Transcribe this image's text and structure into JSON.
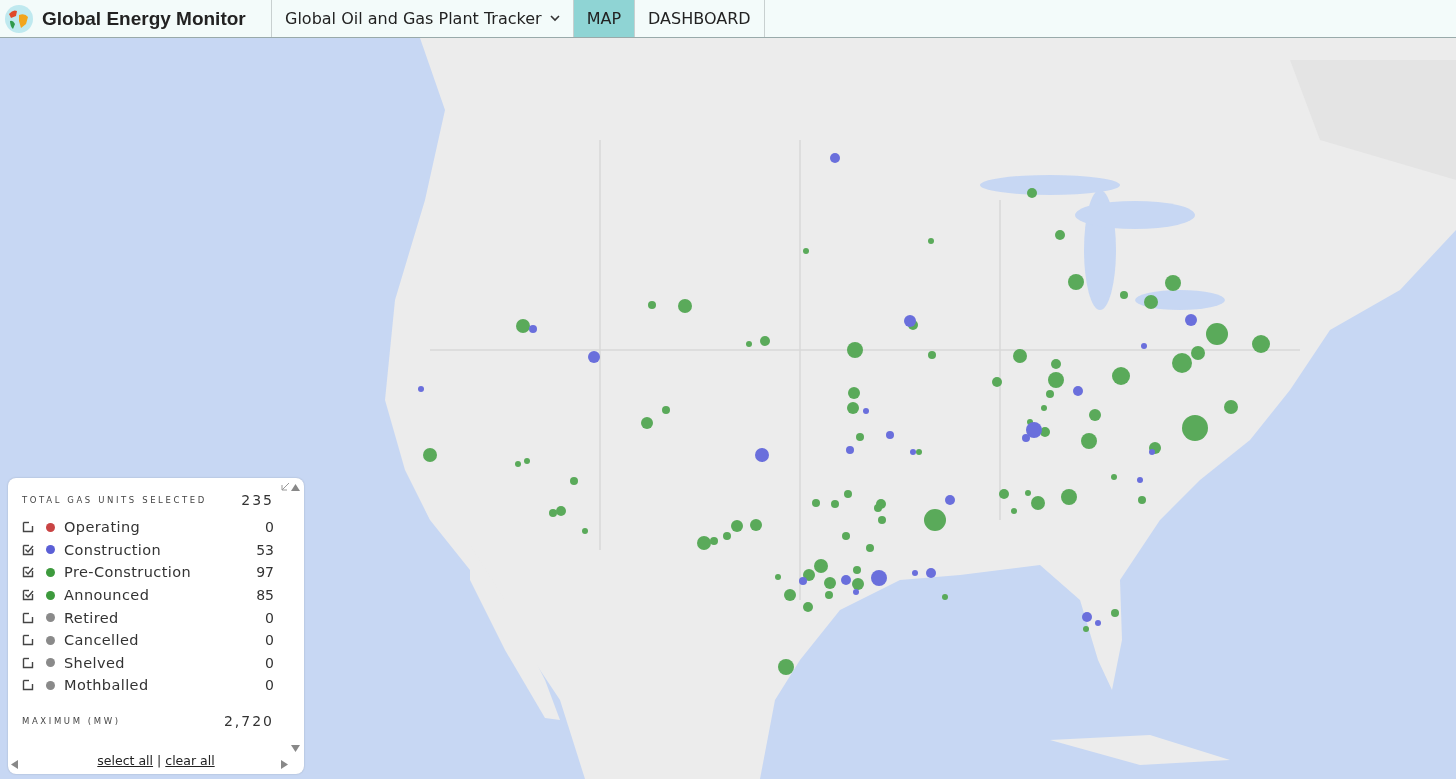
{
  "header": {
    "brand": "Global Energy Monitor",
    "nav": [
      {
        "kind": "dropdown",
        "label": "Global Oil and Gas Plant Tracker",
        "selected": false
      },
      {
        "kind": "tab",
        "label": "MAP",
        "selected": true
      },
      {
        "kind": "tab",
        "label": "DASHBOARD",
        "selected": false
      }
    ]
  },
  "map": {
    "markers": [
      {
        "color": "#5aaa5a"
      },
      {
        "color": "#5aaa5a"
      },
      {
        "color": "#5aaa5a"
      },
      {
        "color": "#5aaa5a"
      },
      {
        "color": "#5aaa5a"
      },
      {
        "color": "#5aaa5a"
      },
      {
        "color": "#5aaa5a"
      },
      {
        "color": "#5aaa5a"
      },
      {
        "color": "#5aaa5a"
      },
      {
        "color": "#5aaa5a"
      },
      {
        "color": "#5aaa5a"
      },
      {
        "color": "#5aaa5a"
      },
      {
        "color": "#5aaa5a"
      },
      {
        "color": "#5aaa5a"
      },
      {
        "color": "#5aaa5a"
      },
      {
        "color": "#5aaa5a"
      },
      {
        "color": "#5aaa5a"
      },
      {
        "color": "#5aaa5a"
      },
      {
        "color": "#5aaa5a"
      },
      {
        "color": "#5aaa5a"
      },
      {
        "color": "#5aaa5a"
      },
      {
        "color": "#5aaa5a"
      },
      {
        "color": "#5aaa5a"
      },
      {
        "color": "#5aaa5a"
      },
      {
        "color": "#5aaa5a"
      },
      {
        "color": "#5aaa5a"
      },
      {
        "color": "#5aaa5a"
      },
      {
        "color": "#5aaa5a"
      },
      {
        "color": "#5aaa5a"
      },
      {
        "color": "#5aaa5a"
      },
      {
        "color": "#5aaa5a"
      },
      {
        "color": "#5aaa5a"
      },
      {
        "color": "#5aaa5a"
      },
      {
        "color": "#5aaa5a"
      },
      {
        "color": "#5aaa5a"
      },
      {
        "color": "#5aaa5a"
      },
      {
        "color": "#5aaa5a"
      },
      {
        "color": "#5aaa5a"
      },
      {
        "color": "#5aaa5a"
      },
      {
        "color": "#5aaa5a"
      },
      {
        "color": "#5aaa5a"
      },
      {
        "color": "#5aaa5a"
      },
      {
        "color": "#5aaa5a"
      },
      {
        "color": "#5aaa5a"
      },
      {
        "color": "#5aaa5a"
      },
      {
        "color": "#5aaa5a"
      },
      {
        "color": "#5aaa5a"
      },
      {
        "color": "#5aaa5a"
      },
      {
        "color": "#5aaa5a"
      },
      {
        "color": "#5aaa5a"
      },
      {
        "color": "#5aaa5a"
      },
      {
        "color": "#5aaa5a"
      },
      {
        "color": "#5aaa5a"
      },
      {
        "color": "#5aaa5a"
      },
      {
        "color": "#5aaa5a"
      },
      {
        "color": "#5aaa5a"
      },
      {
        "color": "#5aaa5a"
      },
      {
        "color": "#5aaa5a"
      },
      {
        "color": "#5aaa5a"
      },
      {
        "color": "#5aaa5a"
      },
      {
        "color": "#5aaa5a"
      },
      {
        "color": "#5aaa5a"
      },
      {
        "color": "#5aaa5a"
      },
      {
        "color": "#5aaa5a"
      },
      {
        "color": "#5aaa5a"
      },
      {
        "color": "#5aaa5a"
      },
      {
        "color": "#5aaa5a"
      },
      {
        "color": "#5aaa5a"
      },
      {
        "color": "#5aaa5a"
      },
      {
        "color": "#5aaa5a"
      },
      {
        "color": "#5aaa5a"
      },
      {
        "color": "#5aaa5a"
      },
      {
        "color": "#5aaa5a"
      },
      {
        "color": "#5aaa5a"
      },
      {
        "color": "#5aaa5a"
      },
      {
        "color": "#5aaa5a"
      },
      {
        "color": "#5aaa5a"
      },
      {
        "color": "#5aaa5a"
      },
      {
        "color": "#5aaa5a"
      },
      {
        "color": "#5aaa5a"
      },
      {
        "color": "#5aaa5a"
      },
      {
        "color": "#6a6fdc"
      },
      {
        "color": "#6a6fdc"
      },
      {
        "color": "#6a6fdc"
      },
      {
        "color": "#6a6fdc"
      },
      {
        "color": "#6a6fdc"
      },
      {
        "color": "#6a6fdc"
      },
      {
        "color": "#6a6fdc"
      },
      {
        "color": "#6a6fdc"
      },
      {
        "color": "#6a6fdc"
      },
      {
        "color": "#6a6fdc"
      },
      {
        "color": "#6a6fdc"
      },
      {
        "color": "#6a6fdc"
      },
      {
        "color": "#6a6fdc"
      },
      {
        "color": "#6a6fdc"
      },
      {
        "color": "#6a6fdc"
      },
      {
        "color": "#6a6fdc"
      },
      {
        "color": "#6a6fdc"
      },
      {
        "color": "#6a6fdc"
      },
      {
        "color": "#6a6fdc"
      },
      {
        "color": "#6a6fdc"
      },
      {
        "color": "#6a6fdc"
      },
      {
        "color": "#6a6fdc"
      },
      {
        "color": "#6a6fdc"
      },
      {
        "color": "#6a6fdc"
      },
      {
        "color": "#6a6fdc"
      },
      {
        "color": "#6a6fdc"
      }
    ]
  },
  "legend": {
    "title": "TOTAL GAS UNITS SELECTED",
    "total": "235",
    "items": [
      {
        "label": "Operating",
        "count": "0",
        "color": "#c94444",
        "checked": false
      },
      {
        "label": "Construction",
        "count": "53",
        "color": "#5b5fd6",
        "checked": true
      },
      {
        "label": "Pre-Construction",
        "count": "97",
        "color": "#3d9a3d",
        "checked": true
      },
      {
        "label": "Announced",
        "count": "85",
        "color": "#3d9a3d",
        "checked": true
      },
      {
        "label": "Retired",
        "count": "0",
        "color": "#8a8a8a",
        "checked": false
      },
      {
        "label": "Cancelled",
        "count": "0",
        "color": "#8a8a8a",
        "checked": false
      },
      {
        "label": "Shelved",
        "count": "0",
        "color": "#8a8a8a",
        "checked": false
      },
      {
        "label": "Mothballed",
        "count": "0",
        "color": "#8a8a8a",
        "checked": false
      }
    ],
    "maximum_label": "MAXIMUM (MW)",
    "maximum": "2,720",
    "select_all": "select all",
    "separator": "|",
    "clear_all": "clear all"
  }
}
